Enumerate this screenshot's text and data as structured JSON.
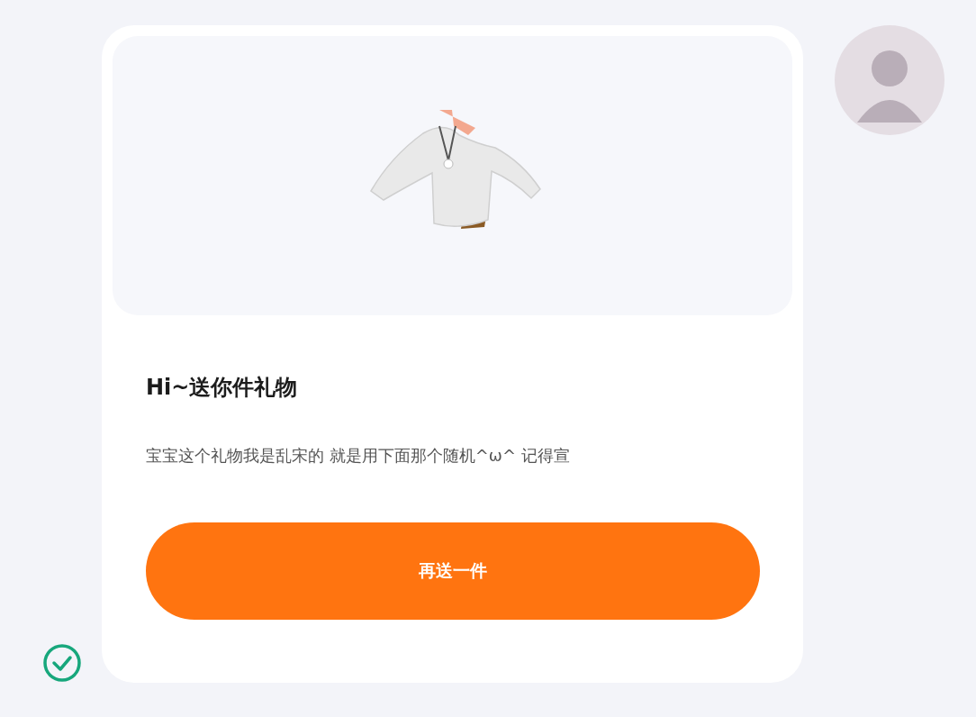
{
  "card": {
    "title": "Hi~送你件礼物",
    "message": "宝宝这个礼物我是乱宋的 就是用下面那个随机^ω^ 记得宣",
    "button": "再送一件"
  }
}
